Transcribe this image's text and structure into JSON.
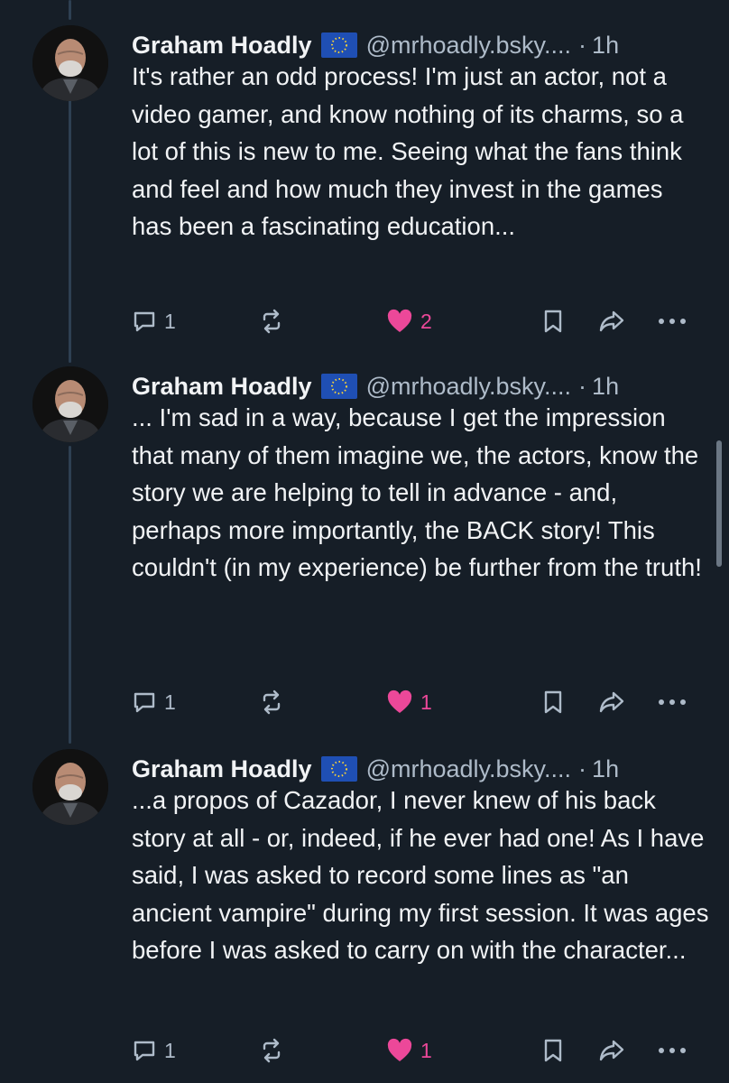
{
  "posts": [
    {
      "author": "Graham Hoadly",
      "handle": "@mrhoadly.bsky....",
      "separator": "·",
      "time": "1h",
      "text": "It's rather an odd process! I'm just an actor, not a video gamer, and know nothing of its charms, so a lot of this is new to me. Seeing what the fans think and feel and how much they invest in the games has been a fascinating education...",
      "replies": "1",
      "likes": "2"
    },
    {
      "author": "Graham Hoadly",
      "handle": "@mrhoadly.bsky....",
      "separator": "·",
      "time": "1h",
      "text": "... I'm sad in a way, because I get the impression that many of them imagine we, the actors, know the story we are helping to tell in advance - and, perhaps more importantly, the BACK story! This couldn't (in my experience) be further from the truth!",
      "replies": "1",
      "likes": "1"
    },
    {
      "author": "Graham Hoadly",
      "handle": "@mrhoadly.bsky....",
      "separator": "·",
      "time": "1h",
      "text": "...a propos of Cazador, I never knew of his back story at all - or, indeed, if he ever had one! As I have said, I was asked to record some lines as \"an ancient vampire\" during my first session. It was ages before I was asked to carry on with the character...",
      "replies": "1",
      "likes": "1"
    }
  ],
  "icons": {
    "reply": "reply-icon",
    "repost": "repost-icon",
    "like": "heart-icon",
    "bookmark": "bookmark-icon",
    "share": "share-icon",
    "more": "more-icon",
    "flag": "eu-flag-icon"
  },
  "colors": {
    "background": "#161e27",
    "text": "#f1f3f5",
    "muted": "#aebbc9",
    "like": "#ec4899",
    "thread_line": "#2e4052"
  }
}
